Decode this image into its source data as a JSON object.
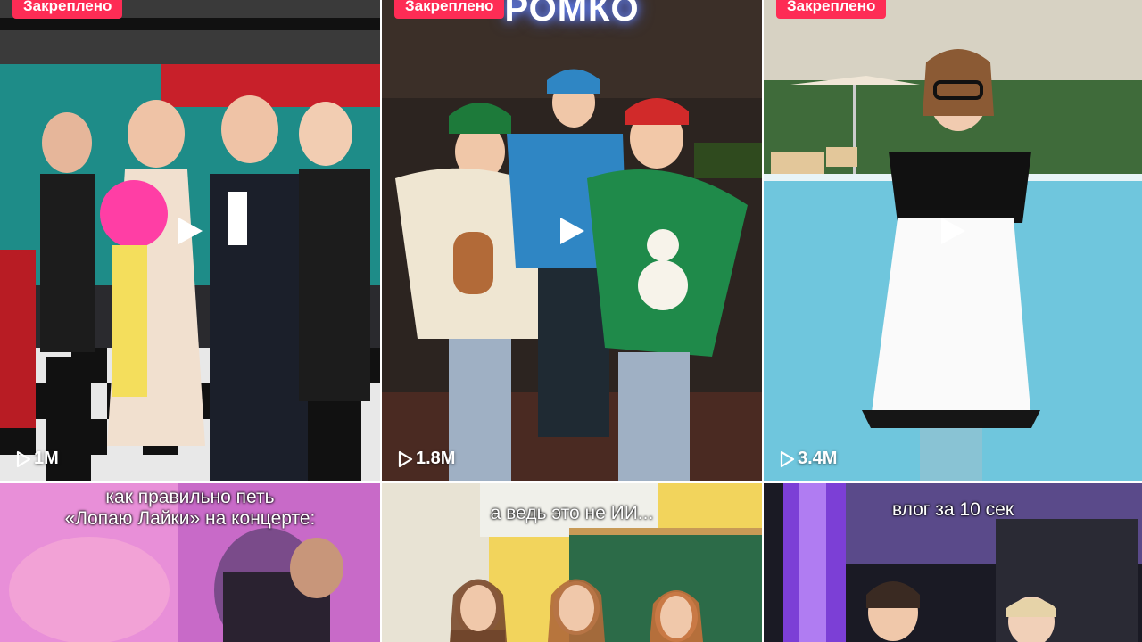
{
  "tiles": [
    {
      "pinned_label": "Закреплено",
      "views": "1M"
    },
    {
      "pinned_label": "Закреплено",
      "views": "1.8M",
      "brand": "РОМКО"
    },
    {
      "pinned_label": "Закреплено",
      "views": "3.4M"
    },
    {
      "caption": "как правильно петь\n«Лопаю Лайки» на концерте:"
    },
    {
      "caption": "а ведь это не ИИ..."
    },
    {
      "caption": "влог за 10 сек"
    }
  ],
  "colors": {
    "pinned_badge": "#fe2c55",
    "background": "#ffffff"
  },
  "icons": {
    "views": "play-outline-icon",
    "center": "play-icon"
  }
}
